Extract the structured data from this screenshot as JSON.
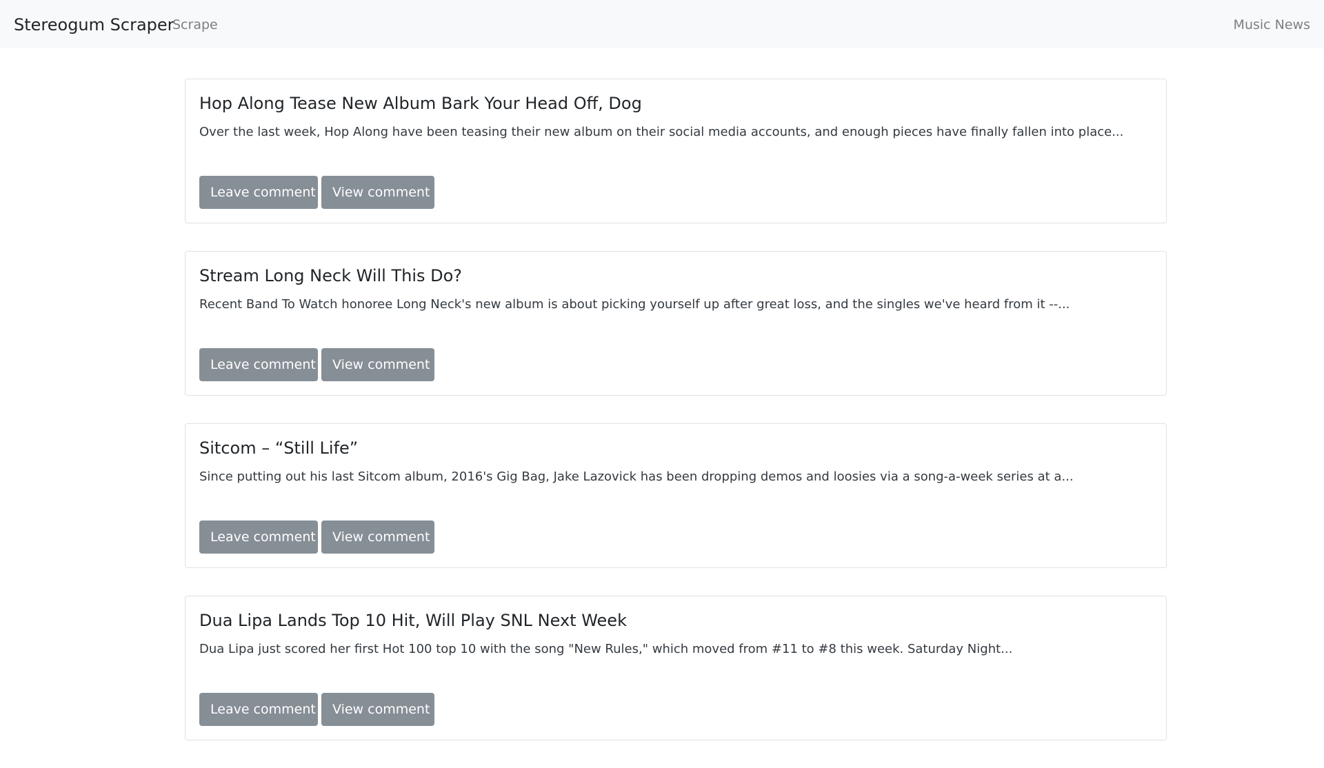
{
  "navbar": {
    "brand": "Stereogum Scraper",
    "scrape_link": "Scrape",
    "music_news_link": "Music News"
  },
  "articles": [
    {
      "title": "Hop Along Tease New Album Bark Your Head Off, Dog",
      "summary": "Over the last week, Hop Along have been teasing their new album on their social media accounts, and enough pieces have finally fallen into place...",
      "leave_label": "Leave comment",
      "view_label": "View comment"
    },
    {
      "title": "Stream Long Neck Will This Do?",
      "summary": "Recent Band To Watch honoree Long Neck's new album is about picking yourself up after great loss, and the singles we've heard from it --...",
      "leave_label": "Leave comment",
      "view_label": "View comment"
    },
    {
      "title": "Sitcom – “Still Life”",
      "summary": "Since putting out his last Sitcom album, 2016's Gig Bag, Jake Lazovick has been dropping demos and loosies via a song-a-week series at a...",
      "leave_label": "Leave comment",
      "view_label": "View comment"
    },
    {
      "title": "Dua Lipa Lands Top 10 Hit, Will Play SNL Next Week",
      "summary": "Dua Lipa just scored her first Hot 100 top 10 with the song \"New Rules,\" which moved from #11 to #8 this week. Saturday Night...",
      "leave_label": "Leave comment",
      "view_label": "View comment"
    }
  ]
}
